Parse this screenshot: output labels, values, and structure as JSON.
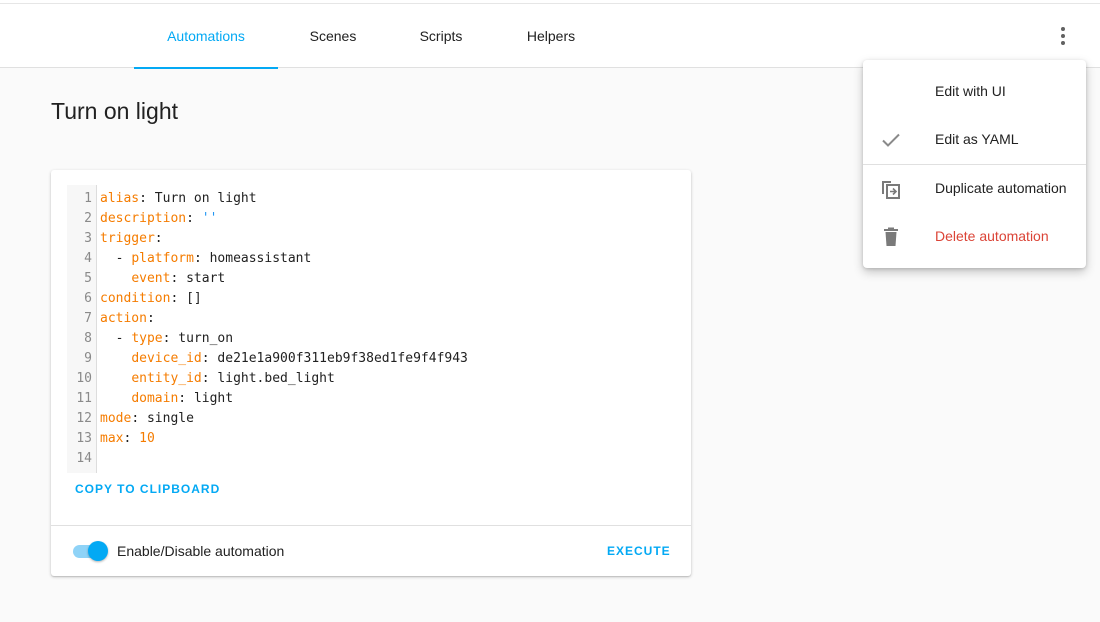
{
  "tabs": [
    {
      "label": "Automations",
      "active": true
    },
    {
      "label": "Scenes",
      "active": false
    },
    {
      "label": "Scripts",
      "active": false
    },
    {
      "label": "Helpers",
      "active": false
    }
  ],
  "page_title": "Turn on light",
  "editor": {
    "lines": [
      {
        "num": "1",
        "indent": "",
        "key": "alias",
        "sep": ": ",
        "value": "Turn on light",
        "value_type": "text"
      },
      {
        "num": "2",
        "indent": "",
        "key": "description",
        "sep": ": ",
        "value": "''",
        "value_type": "string"
      },
      {
        "num": "3",
        "indent": "",
        "key": "trigger",
        "sep": ":",
        "value": "",
        "value_type": "text"
      },
      {
        "num": "4",
        "indent": "  - ",
        "key": "platform",
        "sep": ": ",
        "value": "homeassistant",
        "value_type": "text"
      },
      {
        "num": "5",
        "indent": "    ",
        "key": "event",
        "sep": ": ",
        "value": "start",
        "value_type": "text"
      },
      {
        "num": "6",
        "indent": "",
        "key": "condition",
        "sep": ": ",
        "value": "[]",
        "value_type": "text"
      },
      {
        "num": "7",
        "indent": "",
        "key": "action",
        "sep": ":",
        "value": "",
        "value_type": "text"
      },
      {
        "num": "8",
        "indent": "  - ",
        "key": "type",
        "sep": ": ",
        "value": "turn_on",
        "value_type": "text"
      },
      {
        "num": "9",
        "indent": "    ",
        "key": "device_id",
        "sep": ": ",
        "value": "de21e1a900f311eb9f38ed1fe9f4f943",
        "value_type": "text"
      },
      {
        "num": "10",
        "indent": "    ",
        "key": "entity_id",
        "sep": ": ",
        "value": "light.bed_light",
        "value_type": "text"
      },
      {
        "num": "11",
        "indent": "    ",
        "key": "domain",
        "sep": ": ",
        "value": "light",
        "value_type": "text"
      },
      {
        "num": "12",
        "indent": "",
        "key": "mode",
        "sep": ": ",
        "value": "single",
        "value_type": "text"
      },
      {
        "num": "13",
        "indent": "",
        "key": "max",
        "sep": ": ",
        "value": "10",
        "value_type": "number"
      },
      {
        "num": "14",
        "indent": "",
        "key": "",
        "sep": "",
        "value": "",
        "value_type": "text"
      }
    ]
  },
  "copy_label": "COPY TO CLIPBOARD",
  "toggle": {
    "label": "Enable/Disable automation",
    "on": true
  },
  "execute_label": "EXECUTE",
  "menu": {
    "items": [
      {
        "label": "Edit with UI",
        "icon": "none",
        "checked": false
      },
      {
        "label": "Edit as YAML",
        "icon": "check-icon",
        "checked": true
      },
      {
        "label": "Duplicate automation",
        "icon": "content-duplicate-icon"
      },
      {
        "label": "Delete automation",
        "icon": "delete-icon",
        "danger": true
      }
    ]
  },
  "colors": {
    "accent": "#03a9f4",
    "danger": "#db4437",
    "yaml_key": "#f57c00",
    "yaml_string": "#2196f3"
  }
}
